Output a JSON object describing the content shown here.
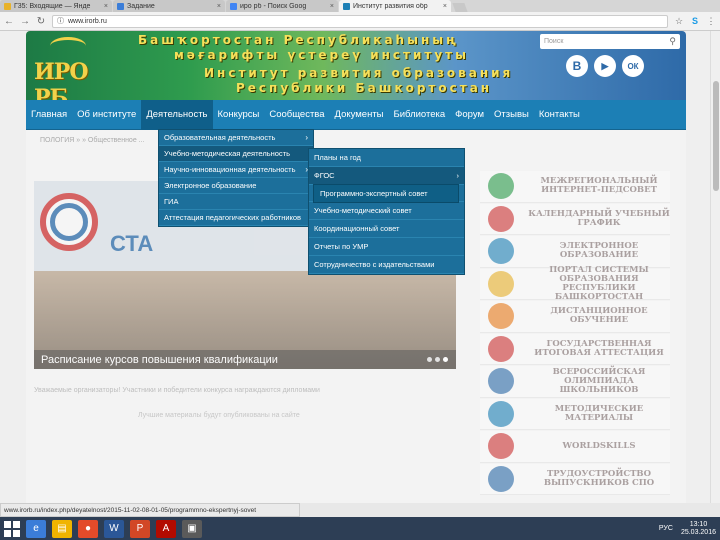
{
  "browser": {
    "tabs": [
      {
        "title": "Г35: Входящие — Янде",
        "color": "#e8b22a"
      },
      {
        "title": "Задание",
        "color": "#3b7dd8"
      },
      {
        "title": "ирo рб - Поиск Goog",
        "color": "#4285f4"
      },
      {
        "title": "Институт развития обр",
        "color": "#1c7fb5"
      }
    ],
    "active_tab": 3,
    "close_glyph": "×",
    "back_icon": "←",
    "forward_icon": "→",
    "reload_icon": "↻",
    "info_icon": "ⓘ",
    "url": "www.irorb.ru",
    "star_icon": "☆",
    "ext_icon": "S",
    "menu_icon": "⋮"
  },
  "header": {
    "logo_text": "ИРО РБ",
    "line1": "Башҡортостан Республикаһының",
    "line2": "мәғарифты үстереү институты",
    "line3": "Институт развития образования",
    "line4": "Республики Башкортостан",
    "search_placeholder": "Поиск",
    "search_icon": "⚲",
    "social": [
      "В",
      "▶",
      "ОК"
    ]
  },
  "menu": {
    "items": [
      "Главная",
      "Об институте",
      "Деятельность",
      "Конкурсы",
      "Сообщества",
      "Документы",
      "Библиотека",
      "Форум",
      "Отзывы",
      "Контакты"
    ],
    "active_index": 2
  },
  "dropdown": {
    "items": [
      {
        "label": "Образовательная деятельность",
        "arrow": true
      },
      {
        "label": "Учебно-методическая деятельность",
        "arrow": false,
        "hl": true
      },
      {
        "label": "Научно-инновационная деятельность",
        "arrow": true
      },
      {
        "label": "Электронное образование",
        "arrow": false
      },
      {
        "label": "ГИА",
        "arrow": false
      },
      {
        "label": "Аттестация педагогических работников",
        "arrow": false
      }
    ],
    "arrow_glyph": "›"
  },
  "submenu": {
    "items": [
      "Планы на год",
      "ФГОС",
      "Программно-экспертный совет",
      "Учебно-методический совет",
      "Координационный совет",
      "Отчеты по УМР",
      "Сотрудничество с издательствами"
    ],
    "sub_arrow": "›"
  },
  "main": {
    "breadcrumb": "ПОЛОГИЯ  »  »  Общественное  ...",
    "slider_caption": "Расписание курсов повышения квалификации",
    "sta_text": "СТА",
    "text1": "Уважаемые организаторы! Участники и победители конкурса награждаются дипломами",
    "text2": "Лучшие материалы будут опубликованы на сайте"
  },
  "right_banners": [
    {
      "label": "Межрегиональный Интернет-педсовет",
      "color": "#2a9b4a"
    },
    {
      "label": "Календарный учебный график",
      "color": "#c33"
    },
    {
      "label": "Электронное образование",
      "color": "#1c7fb5"
    },
    {
      "label": "Портал системы образования Республики Башкортостан",
      "color": "#e8b22a"
    },
    {
      "label": "Дистанционное обучение",
      "color": "#e87a1a"
    },
    {
      "label": "Государственная итоговая аттестация",
      "color": "#c33"
    },
    {
      "label": "Всероссийская олимпиада школьников",
      "color": "#2a6aa8"
    },
    {
      "label": "Методические материалы",
      "color": "#1c7fb5"
    },
    {
      "label": "WorldSkills",
      "color": "#c33"
    },
    {
      "label": "Трудоустройство выпускников СПО",
      "color": "#2a6aa8"
    }
  ],
  "status_url": "www.irorb.ru/index.php/deyatelnost/2015-11-02-08-01-05/programmno-ekspertnyj-sovet",
  "taskbar": {
    "apps": [
      {
        "glyph": "e",
        "color": "#3b7dd8"
      },
      {
        "glyph": "▤",
        "color": "#f0b400"
      },
      {
        "glyph": "●",
        "color": "#e34b2a"
      },
      {
        "glyph": "W",
        "color": "#2b5797"
      },
      {
        "glyph": "P",
        "color": "#d24726"
      },
      {
        "glyph": "A",
        "color": "#b30b00"
      },
      {
        "glyph": "▣",
        "color": "#5a5a5a"
      }
    ],
    "lang": "РУС",
    "time": "13:10",
    "date": "25.03.2016"
  }
}
